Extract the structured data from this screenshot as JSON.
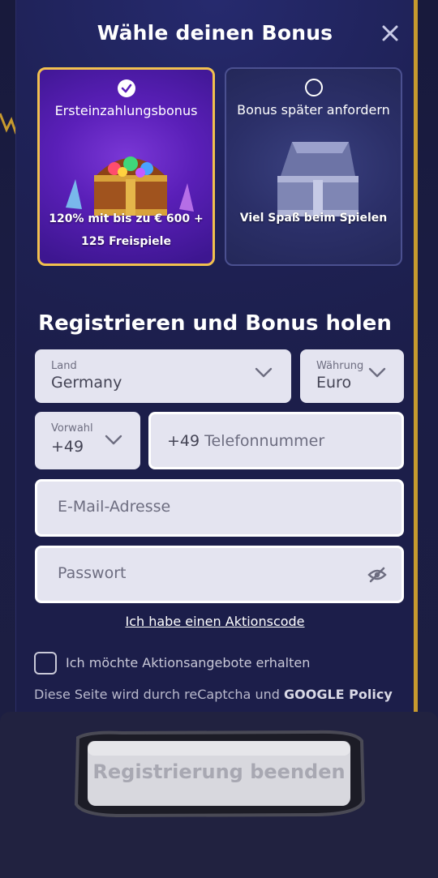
{
  "modal": {
    "title": "Wähle deinen Bonus"
  },
  "bonus_options": [
    {
      "title": "Ersteinzahlungsbonus",
      "subtitle": "120% mit bis zu € 600 + 125 Freispiele",
      "selected": true
    },
    {
      "title": "Bonus später anfordern",
      "subtitle": "Viel Spaß beim Spielen",
      "selected": false
    }
  ],
  "form": {
    "heading": "Registrieren und Bonus holen",
    "country": {
      "label": "Land",
      "value": "Germany"
    },
    "currency": {
      "label": "Währung",
      "value": "Euro"
    },
    "dial_code": {
      "label": "Vorwahl",
      "value": "+49"
    },
    "phone": {
      "prefix": "+49",
      "placeholder": "Telefonnummer"
    },
    "email": {
      "placeholder": "E-Mail-Adresse"
    },
    "password": {
      "placeholder": "Passwort"
    },
    "promo_link": "Ich habe einen Aktionscode",
    "promo_opt_in": {
      "label": "Ich möchte Aktionsangebote erhalten",
      "checked": false
    },
    "recaptcha_text": "Diese Seite wird durch reCaptcha und",
    "recaptcha_bold": "GOOGLE Policy",
    "submit_label": "Registrierung beenden"
  },
  "icons": {
    "close": "close-icon",
    "chevron": "chevron-down-icon",
    "eye_slash": "eye-slash-icon",
    "check": "check-icon"
  },
  "colors": {
    "accent_gold": "#f2c14e",
    "selected_card": "#5a1fb8",
    "field_bg": "#e4e4f0",
    "modal_bg": "#1f2258"
  }
}
